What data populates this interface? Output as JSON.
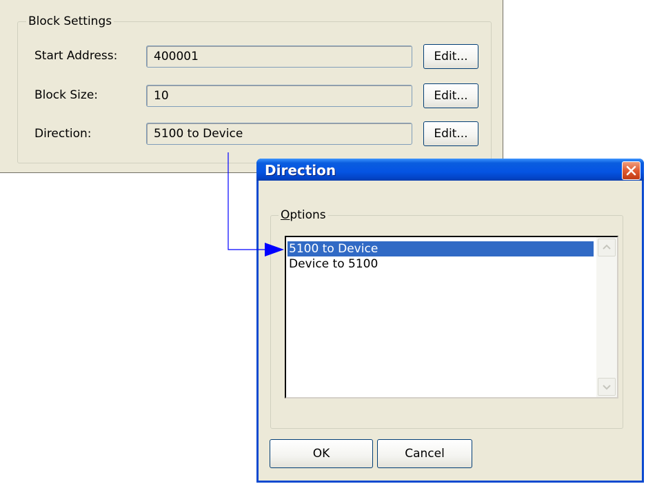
{
  "block_settings": {
    "legend": "Block Settings",
    "rows": [
      {
        "label": "Start Address:",
        "value": "400001",
        "button": "Edit..."
      },
      {
        "label": "Block Size:",
        "value": "10",
        "button": "Edit..."
      },
      {
        "label": "Direction:",
        "value": "5100 to Device",
        "button": "Edit..."
      }
    ]
  },
  "dialog": {
    "title": "Direction",
    "options_legend_prefix": "O",
    "options_legend_rest": "ptions",
    "list_items": [
      "5100 to Device",
      "Device to 5100"
    ],
    "selected_index": 0,
    "ok_label": "OK",
    "cancel_label": "Cancel"
  },
  "colors": {
    "panel_bg": "#ece9d8",
    "titlebar": "#0554e3",
    "selection": "#316ac5",
    "callout_line": "#0000ff"
  },
  "icons": {
    "close": "close-x-icon",
    "scroll_up": "scroll-up-icon",
    "scroll_down": "scroll-down-icon",
    "pointer": "callout-arrow"
  }
}
